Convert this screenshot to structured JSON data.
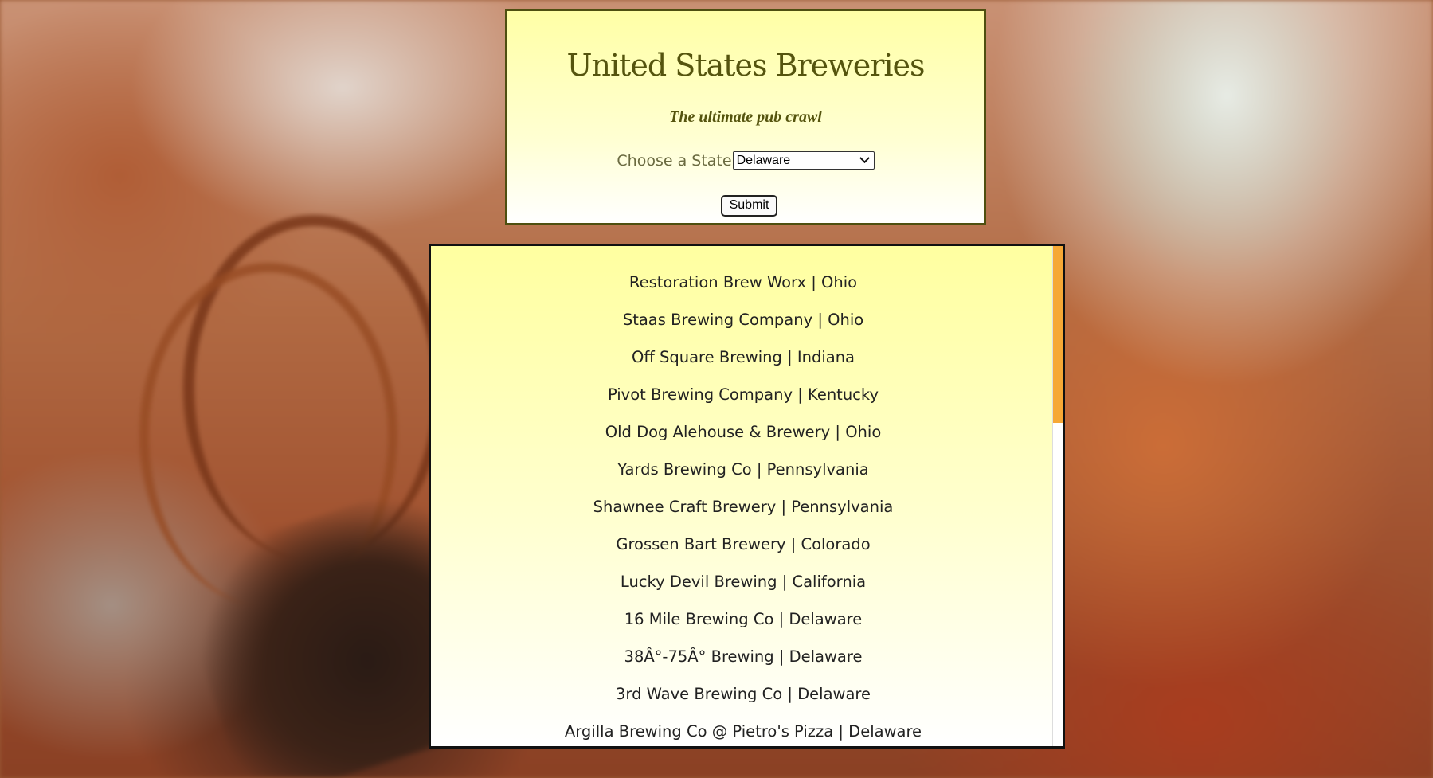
{
  "header": {
    "title": "United States Breweries",
    "subtitle": "The ultimate pub crawl",
    "state_label": "Choose a State",
    "state_selected": "Delaware",
    "submit_label": "Submit"
  },
  "results": [
    {
      "text": "Restoration Brew Worx | Ohio"
    },
    {
      "text": "Staas Brewing Company | Ohio"
    },
    {
      "text": "Off Square Brewing | Indiana"
    },
    {
      "text": "Pivot Brewing Company | Kentucky"
    },
    {
      "text": "Old Dog Alehouse & Brewery | Ohio"
    },
    {
      "text": "Yards Brewing Co | Pennsylvania"
    },
    {
      "text": "Shawnee Craft Brewery | Pennsylvania"
    },
    {
      "text": "Grossen Bart Brewery | Colorado"
    },
    {
      "text": "Lucky Devil Brewing | California"
    },
    {
      "text": "16 Mile Brewing Co | Delaware"
    },
    {
      "text": "38Â°-75Â° Brewing | Delaware"
    },
    {
      "text": "3rd Wave Brewing Co | Delaware"
    },
    {
      "text": "Argilla Brewing Co @ Pietro's Pizza | Delaware"
    }
  ],
  "colors": {
    "title": "#55540e",
    "header_border": "#4e4f10",
    "panel_top": "#ffffa0",
    "scroll_thumb": "#f6a835"
  },
  "scroll_position": 0
}
